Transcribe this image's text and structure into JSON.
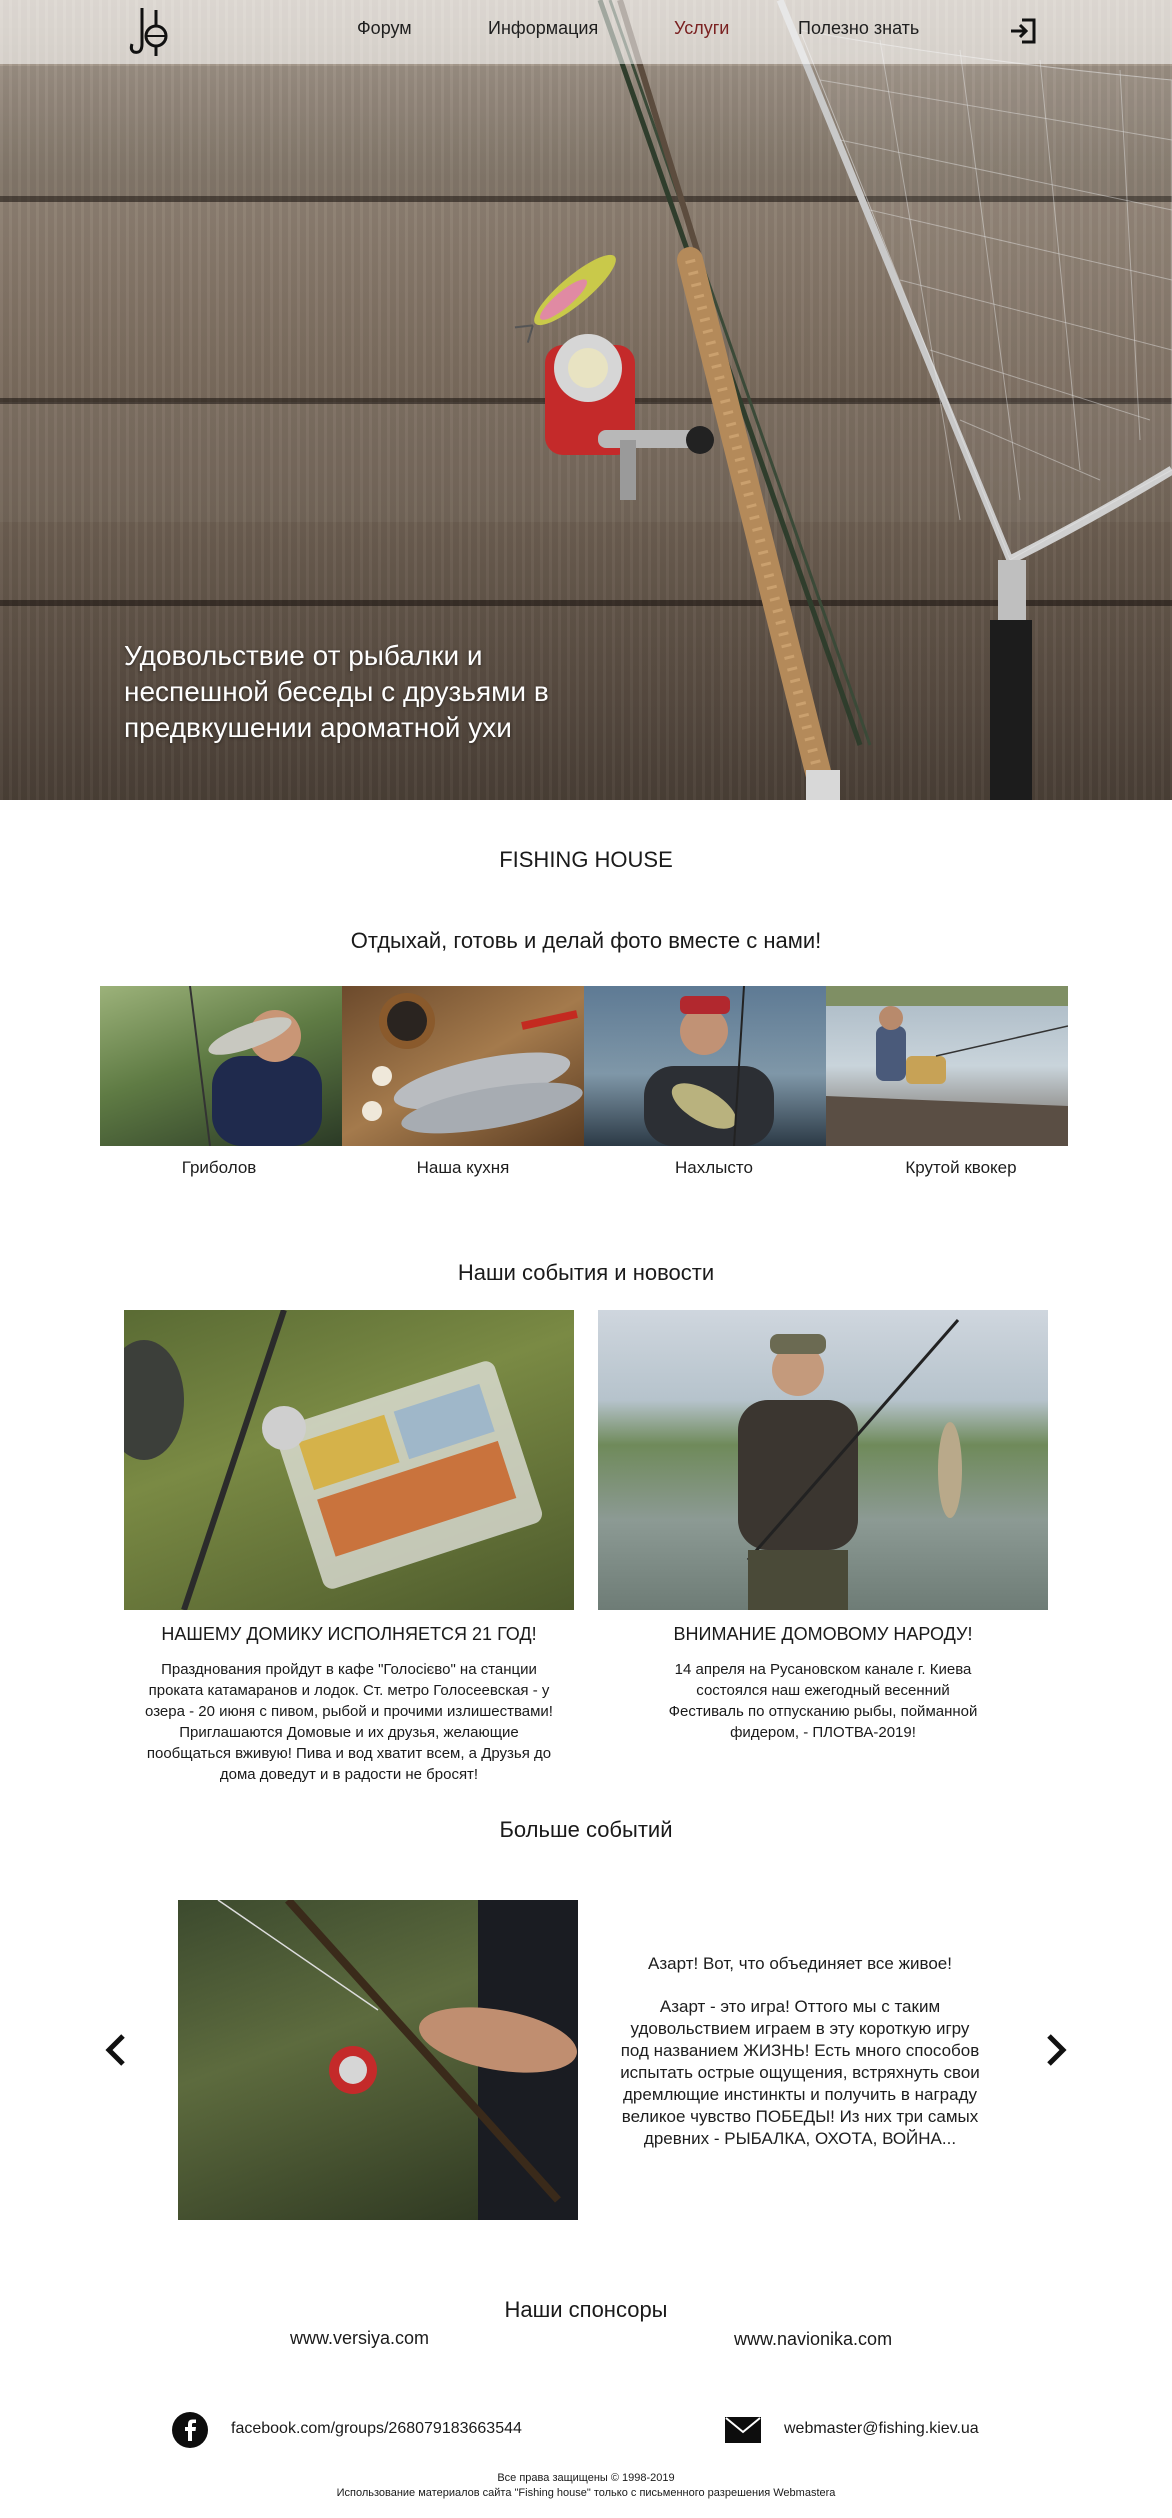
{
  "nav": {
    "items": [
      {
        "label": "Форум"
      },
      {
        "label": "Информация"
      },
      {
        "label": "Услуги",
        "active": true
      },
      {
        "label": "Полезно знать"
      }
    ],
    "active_color": "#7a2121",
    "login_icon": "sign-in-icon"
  },
  "hero": {
    "tagline_lines": [
      "Удовольствие от рыбалки и",
      "неспешной беседы с друзьями в",
      "предвкушении ароматной ухи"
    ]
  },
  "site_title": "FISHING HOUSE",
  "categories_heading": "Отдыхай, готовь  и делай фото вместе с нами!",
  "categories": [
    {
      "label": "Гриболов",
      "photo": "angler-holding-fish"
    },
    {
      "label": "Наша кухня",
      "photo": "fish-with-spices"
    },
    {
      "label": "Нахлысто",
      "photo": "fly-fishing-catch"
    },
    {
      "label": "Крутой квокер",
      "photo": "fishing-on-pier"
    }
  ],
  "news_heading": "Наши события и новости",
  "news": [
    {
      "title": "НАШЕМУ ДОМИКУ ИСПОЛНЯЕТСЯ 21 ГОД!",
      "lines": [
        "Празднования пройдут в кафе \"Голосієво\" на станции",
        "проката катамаранов и лодок. Ст. метро Голосеевская - у",
        "озера - 20 июня с пивом, рыбой и прочими излишествами!",
        "Приглашаются Домовые и их друзья, желающие",
        "пообщаться вживую! Пива и вод хватит всем, а Друзья до",
        "дома доведут и в радости не бросят!"
      ]
    },
    {
      "title": "ВНИМАНИЕ ДОМОВОМУ НАРОДУ!",
      "lines": [
        "14 апреля на Русановском канале г. Киева",
        "состоялся наш ежегодный весенний",
        "Фестиваль по отпусканию рыбы, пойманной",
        "фидером, - ПЛОТВА-2019!"
      ]
    }
  ],
  "more_heading": "Больше событий",
  "carousel": {
    "heading": "Азарт! Вот, что объединяет все живое!",
    "lines": [
      "Азарт - это игра! Оттого мы с таким",
      "удовольствием играем в эту короткую игру",
      "под названием ЖИЗНЬ! Есть много способов",
      "испытать острые ощущения, встряхнуть свои",
      "дремлющие инстинкты и получить в награду",
      "великое чувство ПОБЕДЫ! Из них три самых",
      "древних - РЫБАЛКА, ОХОТА, ВОЙНА..."
    ],
    "prev_icon": "chevron-left-icon",
    "next_icon": "chevron-right-icon"
  },
  "sponsors_heading": "Наши спонсоры",
  "sponsors": [
    "www.versiya.com",
    "www.navionika.com"
  ],
  "contacts": {
    "facebook": "facebook.com/groups/268079183663544",
    "email": "webmaster@fishing.kiev.ua"
  },
  "footer": {
    "copyright": "Все права защищены © 1998-2019",
    "notice": "Использование материалов сайта \"Fishing house\" только с письменного разрешения Webmastera"
  }
}
